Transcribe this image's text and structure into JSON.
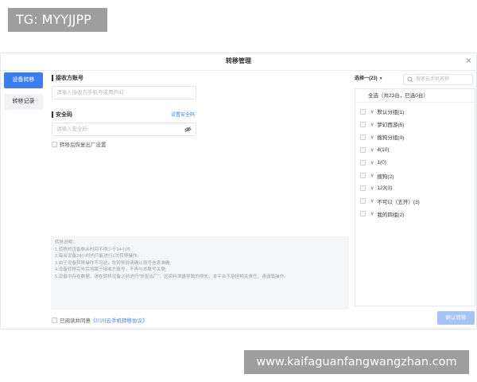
{
  "watermark_top": "TG: MYYJJPP",
  "watermark_bottom": "www.kaifaguanfangwangzhan.com",
  "dialog": {
    "title": "转移管理",
    "close_icon": "close-icon"
  },
  "nav": {
    "items": [
      {
        "label": "设备转移",
        "active": true
      },
      {
        "label": "转移记录",
        "active": false
      }
    ]
  },
  "form": {
    "receiver_label": "接收方账号",
    "receiver_placeholder": "请输入接收方手机号或用户ID",
    "security_label": "安全码",
    "security_link": "设置安全码",
    "security_placeholder": "请输入安全码",
    "restore_checkbox_label": "转移后恢复出厂设置"
  },
  "info": {
    "lines": [
      "转移说明：",
      "1.转移的设备剩余时间不得少于24小时;",
      "2.每台设备24小时内只能进行1次转移操作;",
      "3.由于设备转移操作不可逆，在转移前请确认账号信息准确;",
      "4.设备转移完毕后将属于接收方账号，不再与本账号关联;",
      "5.设备中存在数据，请在转移设备之前进行“恢复出厂”，因资料泄露导致的损失，本平台不承担相关责任，请谨慎操作。"
    ]
  },
  "footer": {
    "agree_prefix": "已阅读并同意",
    "agree_link": "《川川云手机转移协议》",
    "confirm_label": "确认转移"
  },
  "groups_panel": {
    "dropdown_label": "选择一(23)",
    "search_placeholder": "搜索云手机名称",
    "select_all": "全选（共23台，已选0台）",
    "groups": [
      "默认分组(1)",
      "梦幻西游(5)",
      "搜狗分组(0)",
      "4(10)",
      "1(0)",
      "搜狗(2)",
      "123(3)",
      "不可以（五开）(3)",
      "我的四组(2)"
    ]
  }
}
